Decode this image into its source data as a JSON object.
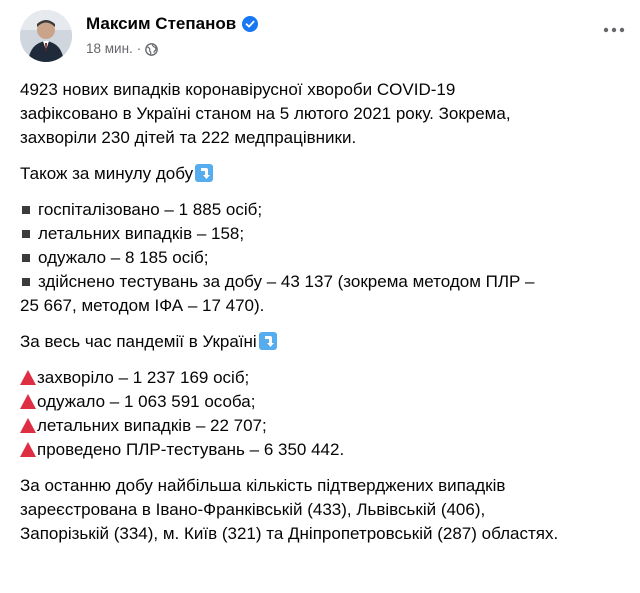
{
  "post": {
    "author": "Максим Степанов",
    "time": "18 мин.",
    "paragraphs": {
      "p1": [
        "4923 нових випадків коронавірусної хвороби COVID-19",
        "зафіксовано в Україні станом на 5 лютого 2021 року. Зокрема,",
        "захворіли 230 дітей та 222 медпрацівники."
      ],
      "p2_heading": "Також за минулу добу",
      "p2_items": [
        "госпіталізовано – 1 885 осіб;",
        "летальних випадків – 158;",
        "одужало – 8 185 осіб;",
        "здійснено тестувань за добу – 43 137 (зокрема методом ПЛР –"
      ],
      "p2_continuation": "25 667, методом ІФА – 17 470).",
      "p3_heading": "За весь час пандемії в Україні",
      "p3_items": [
        "захворіло – 1 237 169 осіб;",
        "одужало – 1 063 591 особа;",
        "летальних випадків – 22 707;",
        "проведено ПЛР-тестувань – 6 350 442."
      ],
      "p4": [
        "За останню добу найбільша кількість підтверджених випадків",
        "зареєстрована в Івано-Франківській (433), Львівській (406),",
        "Запорізькій (334), м. Київ (321) та Дніпропетровській (287) областях."
      ]
    }
  },
  "icons": {
    "verified": "verified-badge-icon",
    "privacy": "globe-icon",
    "more": "more-options-icon",
    "down_arrow": "down-arrow-emoji-icon",
    "bullet_square": "black-small-square-icon",
    "red_triangle": "red-triangle-up-icon"
  },
  "colors": {
    "verified_blue": "#1877f2",
    "meta_gray": "#65676b",
    "triangle_red": "#dd2e44",
    "emoji_blue": "#55acee"
  }
}
